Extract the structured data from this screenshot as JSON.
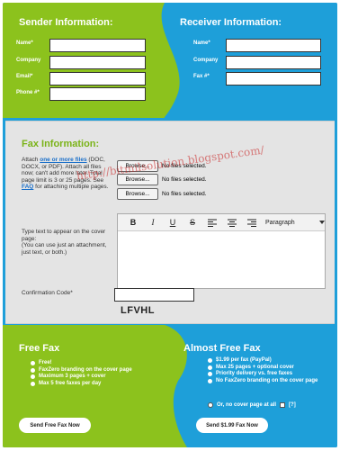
{
  "sender": {
    "title": "Sender Information:",
    "fields": [
      {
        "label": "Name*",
        "value": ""
      },
      {
        "label": "Company",
        "value": ""
      },
      {
        "label": "Email*",
        "value": ""
      },
      {
        "label": "Phone #*",
        "value": ""
      }
    ]
  },
  "receiver": {
    "title": "Receiver Information:",
    "fields": [
      {
        "label": "Name*",
        "value": ""
      },
      {
        "label": "Company",
        "value": ""
      },
      {
        "label": "Fax #*",
        "value": ""
      }
    ]
  },
  "fax": {
    "title": "Fax Information:",
    "attach_pre": "Attach ",
    "attach_link": "one or more files",
    "attach_post": " (DOC, DOCX, or PDF). Attach all files now; can't add more later. Total page limit is 3 or 25 pages. See ",
    "faq_link": "FAQ",
    "attach_end": " for attaching multiple pages.",
    "browse_label": "Browse...",
    "no_file_text": "No files selected.",
    "cover_text": "Type text to appear on the cover page:",
    "cover_note": "(You can use just an attachment, just text, or both.)",
    "toolbar": {
      "bold": "B",
      "italic": "I",
      "underline": "U",
      "strike": "S",
      "paragraph": "Paragraph"
    },
    "confirmation_label": "Confirmation Code*",
    "confirmation_value": "",
    "captcha": "LFVHL"
  },
  "watermark": "http://bitmilsolution.blogspot.com/",
  "free": {
    "title": "Free Fax",
    "features": [
      "Free!",
      "FaxZero branding on the cover page",
      "Maximum 3 pages + cover",
      "Max 5 free faxes per day"
    ],
    "button": "Send Free Fax Now"
  },
  "almost_free": {
    "title": "Almost Free Fax",
    "features": [
      "$1.99 per fax (PayPal)",
      "Max 25 pages + optional cover",
      "Priority delivery vs. free faxes",
      "No FaxZero branding on the cover page"
    ],
    "cover_option": "Or, no cover page at all",
    "help": "[?]",
    "button": "Send $1.99 Fax Now"
  },
  "colors": {
    "green": "#8cc21d",
    "blue": "#1e9fd9",
    "fax_title": "#7ab317"
  },
  "icons": [
    "dropdown-arrow-icon",
    "bullet-icon",
    "align-left-icon",
    "align-center-icon",
    "align-right-icon"
  ]
}
